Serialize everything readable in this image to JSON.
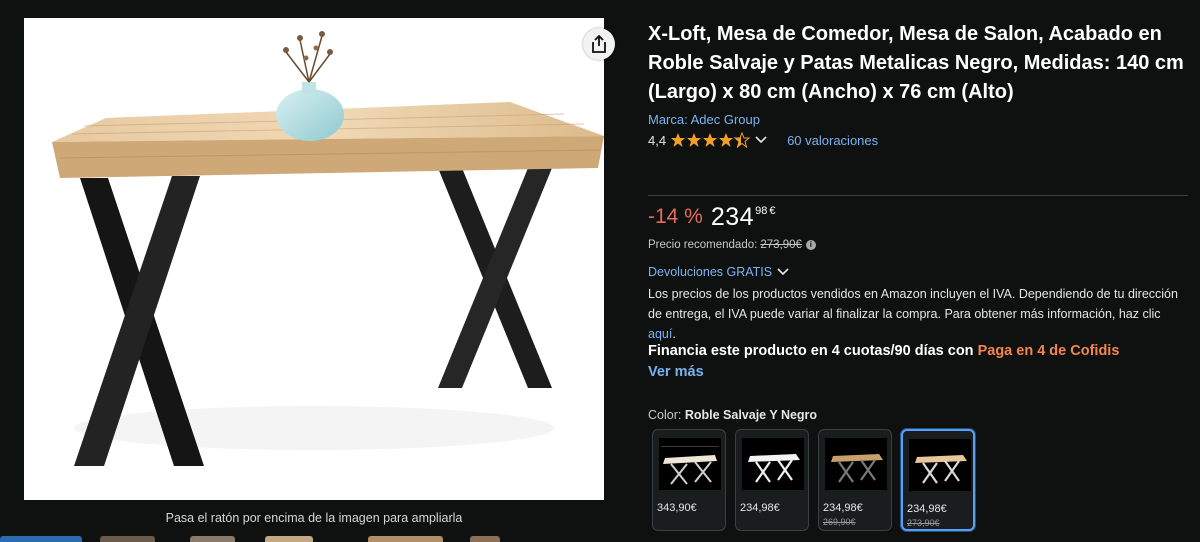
{
  "product": {
    "title": "X-Loft, Mesa de Comedor, Mesa de Salon, Acabado en Roble Salvaje y Patas Metalicas Negro, Medidas: 140 cm (Largo) x 80 cm (Ancho) x 76 cm (Alto)",
    "brand": "Marca: Adec Group",
    "rating_value": "4,4",
    "rating_stars": 4.4,
    "ratings_count": "60 valoraciones"
  },
  "pricing": {
    "discount": "-14 %",
    "price_whole": "234",
    "price_fraction": "98",
    "currency": "€",
    "rrp_label": "Precio recomendado:",
    "rrp_value": "273,90€"
  },
  "returns": {
    "label": "Devoluciones GRATIS"
  },
  "vat": {
    "text": "Los precios de los productos vendidos en Amazon incluyen el IVA. Dependiendo de tu dirección de entrega, el IVA puede variar al finalizar la compra. Para obtener más información, haz clic ",
    "link": "aquí",
    "end": "."
  },
  "financing": {
    "text": "Financia este producto en 4 cuotas/90 días con ",
    "highlight": "Paga en 4 de Cofidis",
    "see_more": "Ver más"
  },
  "color": {
    "label": "Color:",
    "selected": "Roble Salvaje Y Negro",
    "swatches": [
      {
        "price": "343,90€",
        "old_price": ""
      },
      {
        "price": "234,98€",
        "old_price": ""
      },
      {
        "price": "234,98€",
        "old_price": "269,90€"
      },
      {
        "price": "234,98€",
        "old_price": "273,90€"
      }
    ]
  },
  "image": {
    "hover_hint": "Pasa el ratón por encima de la imagen para ampliarla"
  },
  "colors": {
    "link": "#7ab3ef",
    "discount": "#e56b5a",
    "star": "#f0a12b",
    "accent_orange": "#f5854f",
    "selected_border": "#5b9ef0"
  }
}
